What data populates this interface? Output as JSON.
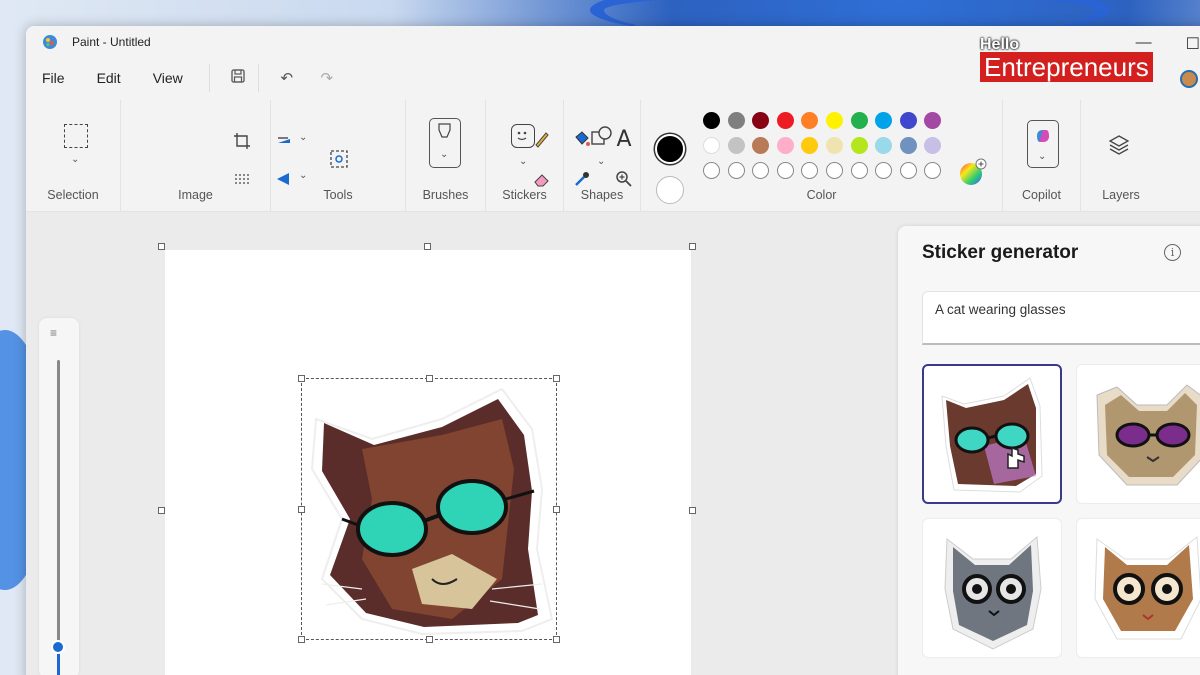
{
  "window": {
    "title": "Paint - Untitled"
  },
  "watermark": {
    "line1": "Hello",
    "line2": "Entrepreneurs"
  },
  "menu": {
    "file": "File",
    "edit": "Edit",
    "view": "View"
  },
  "ribbon": {
    "selection": "Selection",
    "image": "Image",
    "tools": "Tools",
    "brushes": "Brushes",
    "stickers": "Stickers",
    "shapes": "Shapes",
    "color": "Color",
    "copilot": "Copilot",
    "layers": "Layers",
    "text_tool_glyph": "A"
  },
  "colors": {
    "primary": "#000000",
    "secondary": "#ffffff",
    "palette_row1": [
      "#000000",
      "#7f7f7f",
      "#880015",
      "#ed1c24",
      "#ff7f27",
      "#fff200",
      "#22b14c",
      "#00a2e8",
      "#3f48cc",
      "#a349a4"
    ],
    "palette_row2": [
      "#ffffff",
      "#c3c3c3",
      "#b97a57",
      "#ffaec9",
      "#ffc90e",
      "#efe4b0",
      "#b5e61d",
      "#99d9ea",
      "#7092be",
      "#c8bfe7"
    ],
    "accent": "#1a6ad1"
  },
  "sticker_panel": {
    "title": "Sticker generator",
    "info_glyph": "i",
    "prompt": "A cat wearing glasses"
  }
}
